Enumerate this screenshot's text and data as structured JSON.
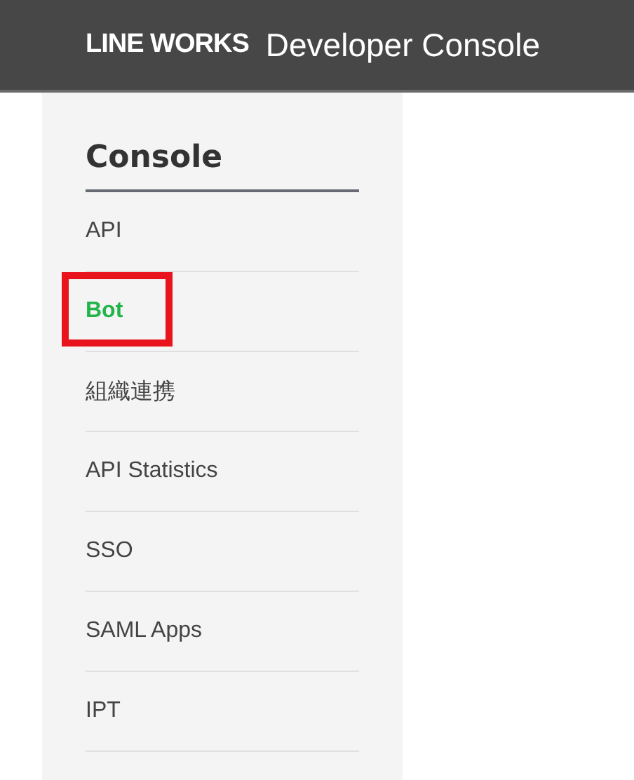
{
  "header": {
    "brand": "LINE WORKS",
    "title": "Developer Console"
  },
  "sidebar": {
    "heading": "Console",
    "items": [
      {
        "label": "API",
        "selected": false,
        "highlighted": false
      },
      {
        "label": "Bot",
        "selected": true,
        "highlighted": true
      },
      {
        "label": "組織連携",
        "selected": false,
        "highlighted": false
      },
      {
        "label": "API Statistics",
        "selected": false,
        "highlighted": false
      },
      {
        "label": "SSO",
        "selected": false,
        "highlighted": false
      },
      {
        "label": "SAML Apps",
        "selected": false,
        "highlighted": false
      },
      {
        "label": "IPT",
        "selected": false,
        "highlighted": false
      }
    ]
  }
}
